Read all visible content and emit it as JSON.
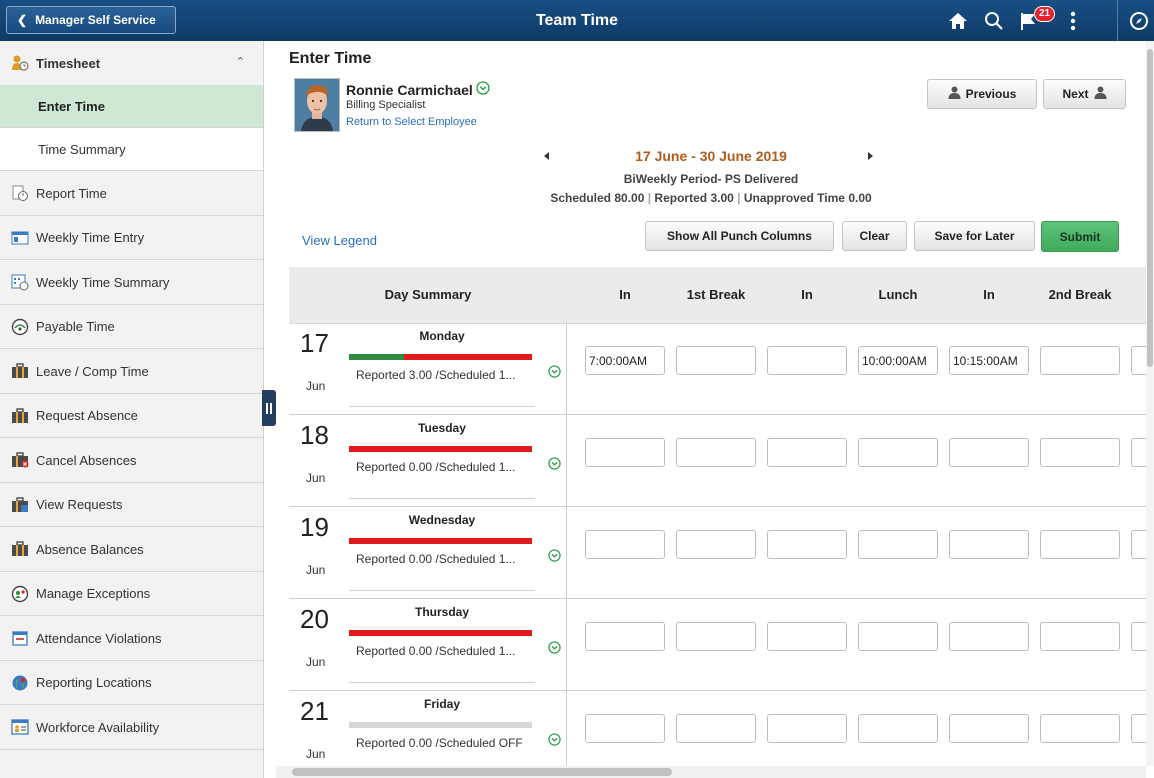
{
  "header": {
    "back_label": "Manager Self Service",
    "title": "Team Time",
    "notification_count": "21"
  },
  "sidebar": {
    "section_label": "Timesheet",
    "sub_items": [
      {
        "label": "Enter Time",
        "selected": true
      },
      {
        "label": "Time Summary",
        "selected": false
      }
    ],
    "items": [
      {
        "label": "Report Time",
        "icon": "report-time-icon"
      },
      {
        "label": "Weekly Time Entry",
        "icon": "weekly-time-entry-icon"
      },
      {
        "label": "Weekly Time Summary",
        "icon": "weekly-summary-icon"
      },
      {
        "label": "Payable Time",
        "icon": "payable-time-icon"
      },
      {
        "label": "Leave / Comp Time",
        "icon": "briefcase-icon"
      },
      {
        "label": "Request Absence",
        "icon": "briefcase-icon"
      },
      {
        "label": "Cancel Absences",
        "icon": "briefcase-cancel-icon"
      },
      {
        "label": "View Requests",
        "icon": "briefcase-view-icon"
      },
      {
        "label": "Absence Balances",
        "icon": "briefcase-icon"
      },
      {
        "label": "Manage Exceptions",
        "icon": "exceptions-icon"
      },
      {
        "label": "Attendance Violations",
        "icon": "calendar-icon"
      },
      {
        "label": "Reporting Locations",
        "icon": "globe-icon"
      },
      {
        "label": "Workforce Availability",
        "icon": "workforce-icon"
      }
    ]
  },
  "main": {
    "page_title": "Enter Time",
    "employee": {
      "name": "Ronnie Carmichael",
      "title": "Billing Specialist",
      "return_link": "Return to Select Employee"
    },
    "previous_label": "Previous",
    "next_label": "Next",
    "period": {
      "range": "17 June - 30 June 2019",
      "type": "BiWeekly Period- PS Delivered",
      "scheduled_label": "Scheduled",
      "scheduled_value": "80.00",
      "reported_label": "Reported",
      "reported_value": "3.00",
      "unapproved_label": "Unapproved Time",
      "unapproved_value": "0.00",
      "range_color": "#b15c1b"
    },
    "view_legend": "View Legend",
    "buttons": {
      "show_all": "Show All Punch Columns",
      "clear": "Clear",
      "save_later": "Save for Later",
      "submit": "Submit"
    },
    "grid": {
      "columns": [
        "Day Summary",
        "In",
        "1st Break",
        "In",
        "Lunch",
        "In",
        "2nd Break"
      ],
      "days": [
        {
          "num": "17",
          "mon": "Jun",
          "name": "Monday",
          "reported": "Reported 3.00 /Scheduled 1...",
          "bar": "partial",
          "green_fraction": 0.3,
          "punches": [
            "7:00:00AM",
            "",
            "",
            "10:00:00AM",
            "10:15:00AM",
            ""
          ]
        },
        {
          "num": "18",
          "mon": "Jun",
          "name": "Tuesday",
          "reported": "Reported 0.00 /Scheduled 1...",
          "bar": "red",
          "green_fraction": 0,
          "punches": [
            "",
            "",
            "",
            "",
            "",
            ""
          ]
        },
        {
          "num": "19",
          "mon": "Jun",
          "name": "Wednesday",
          "reported": "Reported 0.00 /Scheduled 1...",
          "bar": "red",
          "green_fraction": 0,
          "punches": [
            "",
            "",
            "",
            "",
            "",
            ""
          ]
        },
        {
          "num": "20",
          "mon": "Jun",
          "name": "Thursday",
          "reported": "Reported 0.00 /Scheduled 1...",
          "bar": "red",
          "green_fraction": 0,
          "punches": [
            "",
            "",
            "",
            "",
            "",
            ""
          ]
        },
        {
          "num": "21",
          "mon": "Jun",
          "name": "Friday",
          "reported": "Reported 0.00 /Scheduled OFF",
          "bar": "grey",
          "green_fraction": 0,
          "punches": [
            "",
            "",
            "",
            "",
            "",
            ""
          ]
        }
      ]
    }
  },
  "colors": {
    "header_bg": "#0e3a66",
    "selected_item_bg": "#cfe8d4",
    "bar_red": "#e01b1b",
    "bar_green": "#2e8b3f",
    "bar_grey": "#d7d7d7",
    "submit_green": "#4db86a"
  }
}
